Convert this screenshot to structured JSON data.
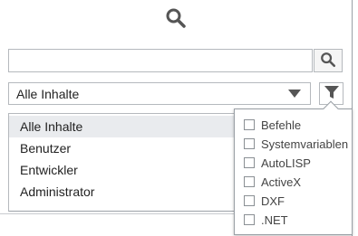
{
  "header": {
    "icon": "search-icon"
  },
  "search": {
    "placeholder": "",
    "value": "",
    "button_icon": "search-icon"
  },
  "filter": {
    "selected": "Alle Inhalte",
    "dropdown_icon": "triangle-down-icon",
    "filter_icon": "funnel-icon"
  },
  "list": {
    "items": [
      {
        "label": "Alle Inhalte",
        "selected": true
      },
      {
        "label": "Benutzer",
        "selected": false
      },
      {
        "label": "Entwickler",
        "selected": false
      },
      {
        "label": "Administrator",
        "selected": false
      }
    ]
  },
  "popup": {
    "options": [
      {
        "label": "Befehle",
        "checked": false
      },
      {
        "label": "Systemvariablen",
        "checked": false
      },
      {
        "label": "AutoLISP",
        "checked": false
      },
      {
        "label": "ActiveX",
        "checked": false
      },
      {
        "label": "DXF",
        "checked": false
      },
      {
        "label": ".NET",
        "checked": false
      }
    ]
  },
  "colors": {
    "icon": "#555555",
    "border": "#b5b9bd",
    "selected_bg": "#e9ebee"
  }
}
